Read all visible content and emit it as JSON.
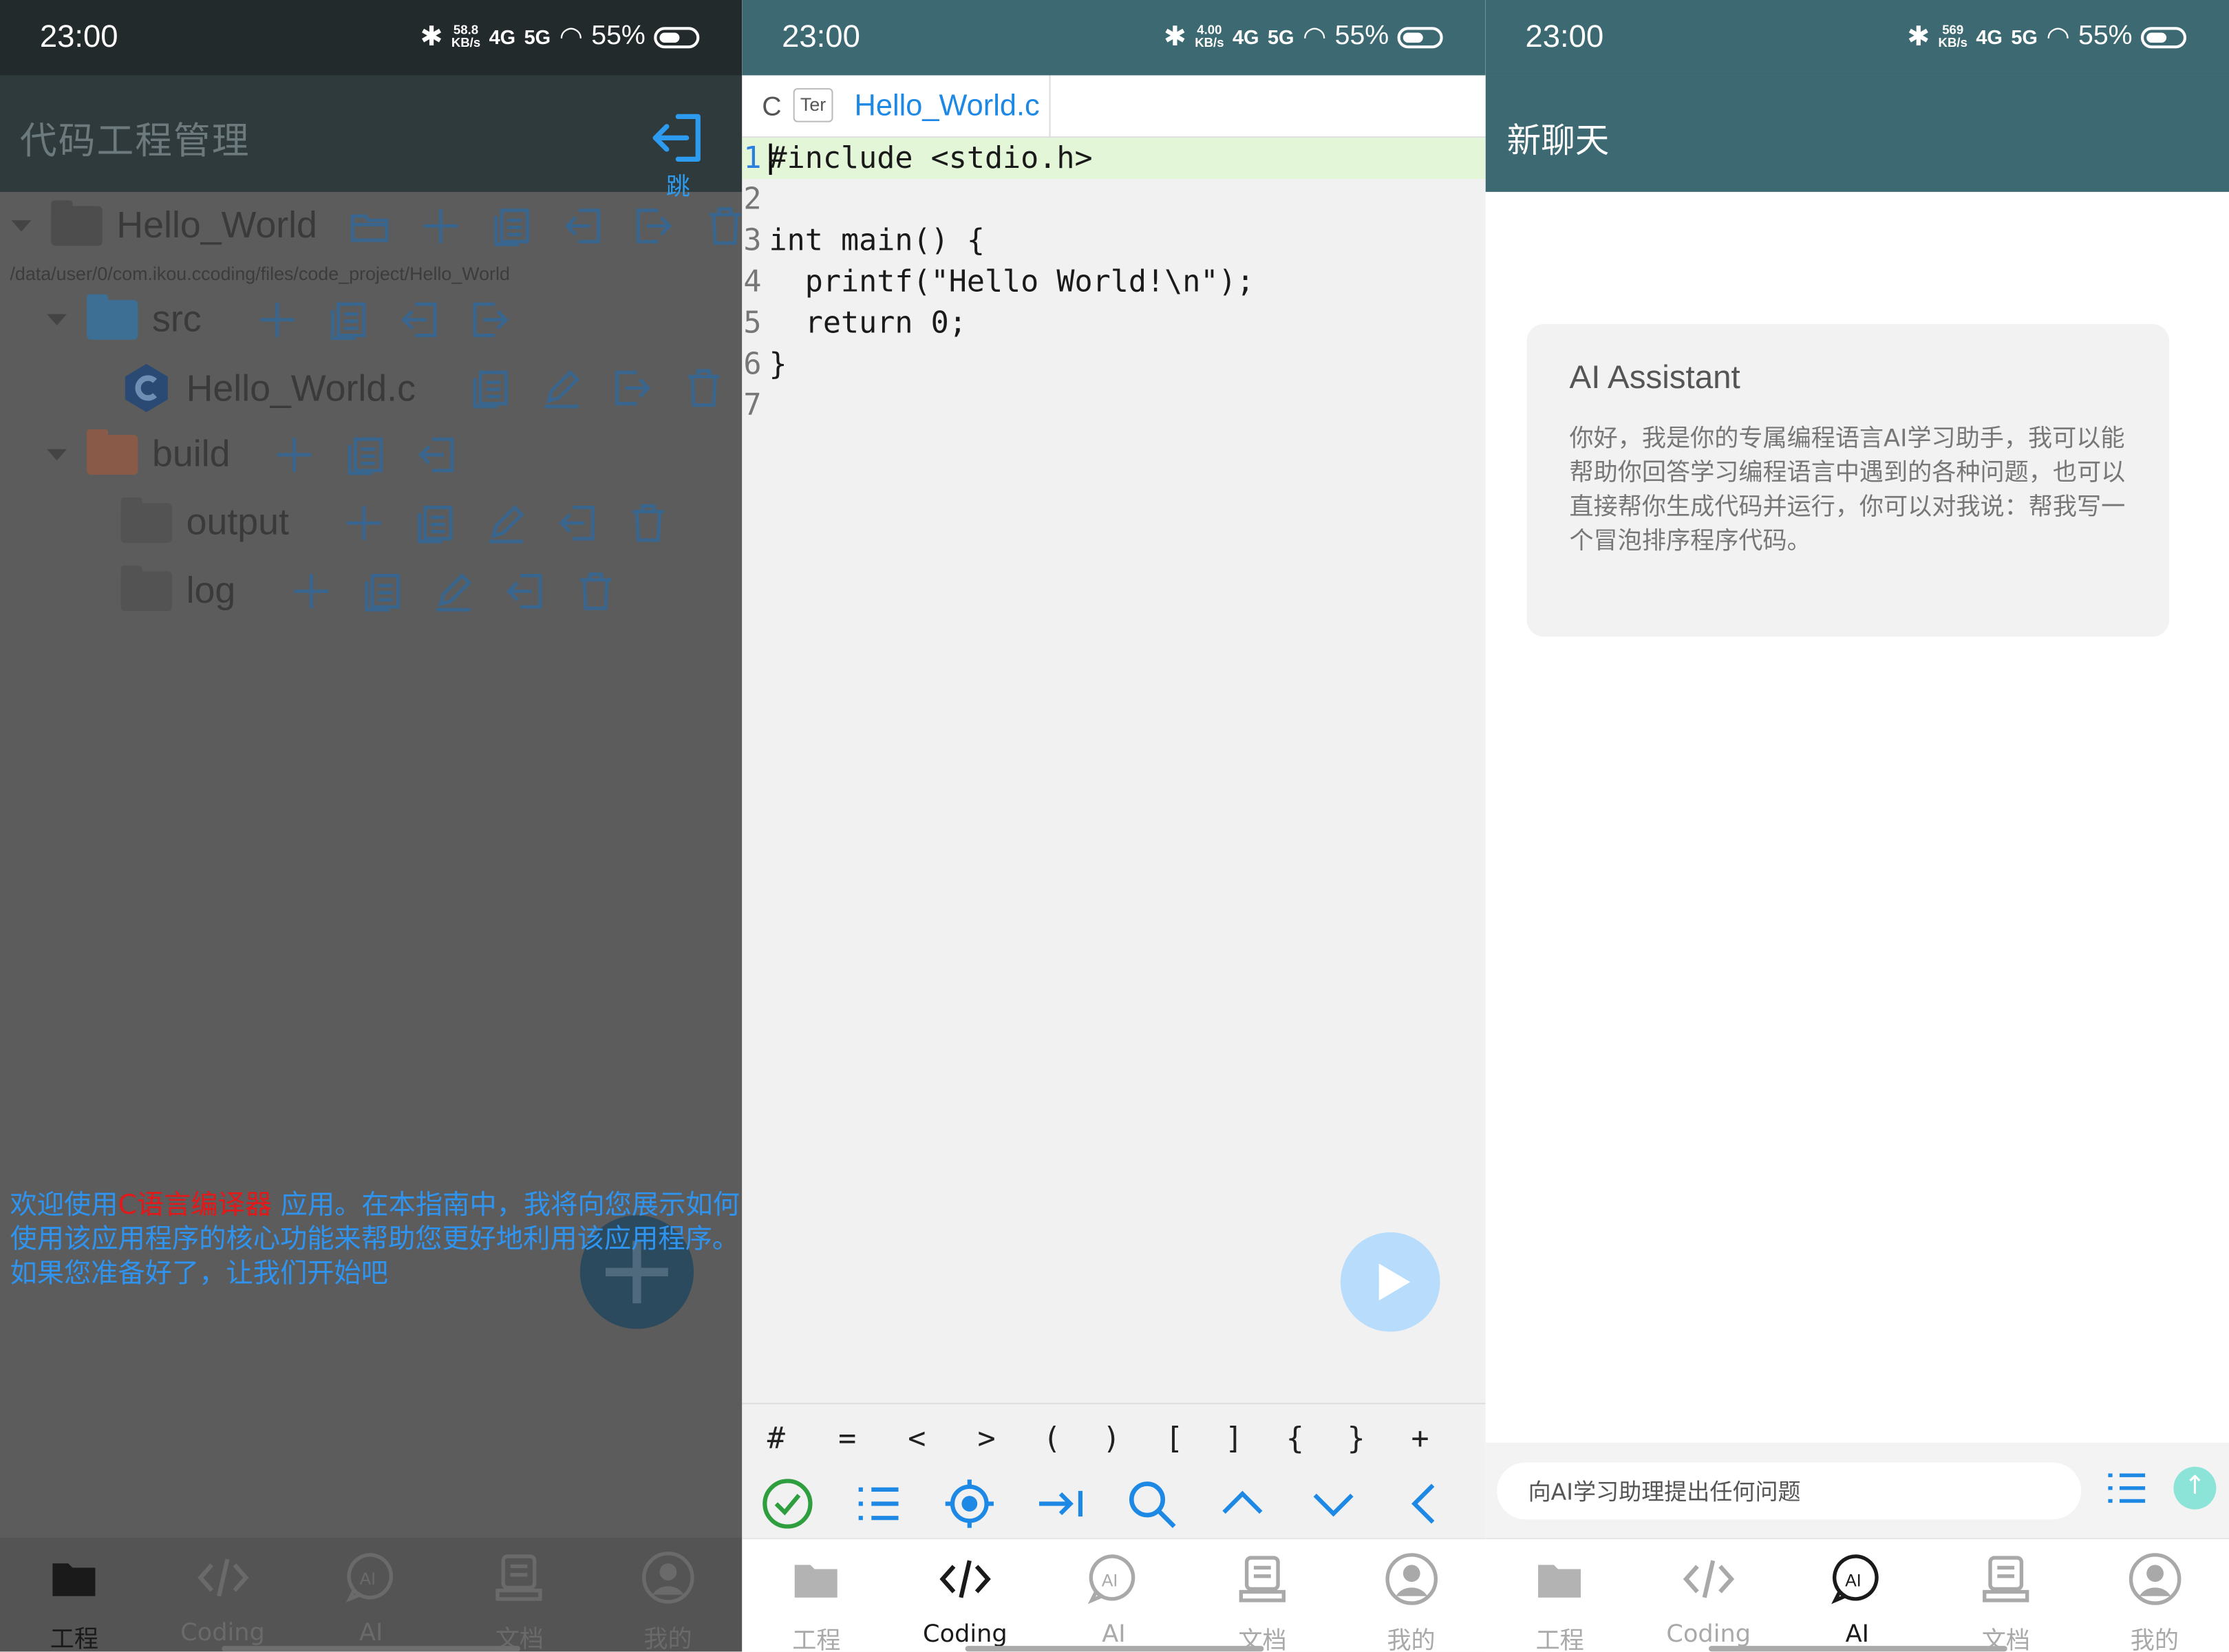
{
  "status": [
    {
      "time": "23:00",
      "speed_top": "58.8",
      "speed_unit": "KB/s",
      "net1": "4G",
      "net2": "5G",
      "battery": "55%"
    },
    {
      "time": "23:00",
      "speed_top": "4.00",
      "speed_unit": "KB/s",
      "net1": "4G",
      "net2": "5G",
      "battery": "55%"
    },
    {
      "time": "23:00",
      "speed_top": "569",
      "speed_unit": "KB/s",
      "net1": "4G",
      "net2": "5G",
      "battery": "55%"
    }
  ],
  "project": {
    "title": "代码工程管理",
    "jump_label": "跳",
    "root_name": "Hello_World",
    "root_path": "/data/user/0/com.ikou.ccoding/files/code_project/Hello_World",
    "src_name": "src",
    "file_name": "Hello_World.c",
    "build_name": "build",
    "output_name": "output",
    "log_name": "log",
    "guide_prefix": "欢迎使用",
    "guide_highlight": "C语言编译器",
    "guide_suffix": " 应用。在本指南中，我将向您展示如何使用该应用程序的核心功能来帮助您更好地利用该应用程序。如果您准备好了，让我们开始吧"
  },
  "editor": {
    "tab_c": "C",
    "tab_ter": "Ter",
    "tab_file": "Hello_World.c",
    "lines": [
      {
        "n": "1",
        "code": "#include <stdio.h>"
      },
      {
        "n": "2",
        "code": ""
      },
      {
        "n": "3",
        "code": "int main() {"
      },
      {
        "n": "4",
        "code": "  printf(\"Hello World!\\n\");"
      },
      {
        "n": "5",
        "code": "  return 0;"
      },
      {
        "n": "6",
        "code": "}"
      },
      {
        "n": "7",
        "code": ""
      }
    ],
    "symbols": [
      "#",
      "=",
      "<",
      ">",
      "(",
      ")",
      "[",
      "]",
      "{",
      "}",
      "+"
    ]
  },
  "chat": {
    "title": "新聊天",
    "assistant_name": "AI Assistant",
    "assistant_message": "你好，我是你的专属编程语言AI学习助手，我可以能帮助你回答学习编程语言中遇到的各种问题，也可以直接帮你生成代码并运行，你可以对我说：帮我写一个冒泡排序程序代码。",
    "input_placeholder": "向AI学习助理提出任何问题"
  },
  "nav": {
    "project": "工程",
    "coding": "Coding",
    "ai": "AI",
    "docs": "文档",
    "mine": "我的"
  },
  "colors": {
    "accent": "#1e88e5",
    "header": "#3d6a72",
    "success": "#2e9e3e",
    "highlight_red": "#e41818"
  }
}
